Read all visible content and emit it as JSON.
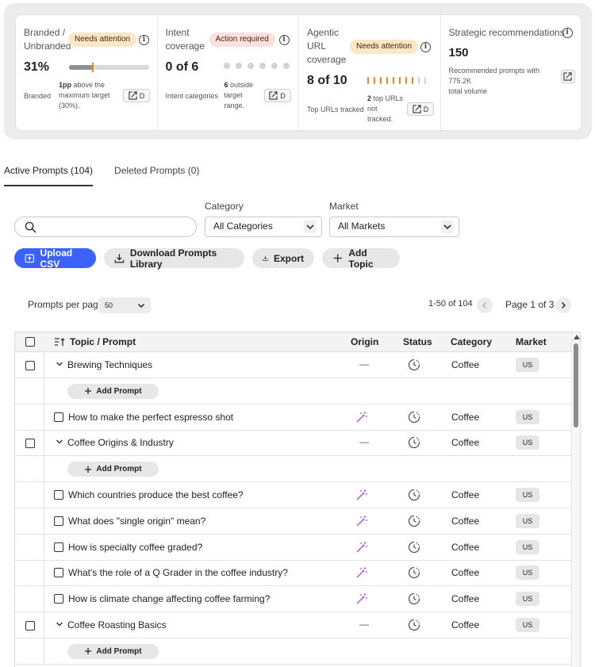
{
  "metrics": {
    "branded": {
      "title_line1": "Branded /",
      "title_line2": "Unbranded",
      "status": "Needs attention",
      "value": "31%",
      "label": "Branded",
      "note_bold": "1pp",
      "note_line1": " above the",
      "note_line2": "maximum target",
      "note_line3": "(30%).",
      "button_label": "D",
      "branded_share": 0.31,
      "max_target": 0.3
    },
    "intent": {
      "title_line1": "Intent",
      "title_line2": "coverage",
      "status": "Action required",
      "value": "0 of 6",
      "label": "Intent categories",
      "note_bold": "6",
      "note_line1": " outside",
      "note_line2": "target",
      "note_line3": "range.",
      "button_label": "D",
      "covered": 0,
      "total": 6
    },
    "agentic": {
      "title_line1": "Agentic",
      "title_line2": "URL",
      "title_line3": "coverage",
      "status": "Needs attention",
      "value": "8 of 10",
      "label": "Top URLs tracked",
      "note_bold": "2",
      "note_line1": " top URLs",
      "note_line2": "not",
      "note_line3": "tracked.",
      "button_label": "D",
      "tracked": 8,
      "total": 10
    },
    "strategic": {
      "title": "Strategic recommendations",
      "value": "150",
      "note_line1": "Recommended prompts with 775.2K",
      "note_line2": "total volume"
    }
  },
  "tabs": [
    {
      "label": "Active Prompts (104)",
      "active": true
    },
    {
      "label": "Deleted Prompts (0)",
      "active": false
    }
  ],
  "filters": {
    "search_placeholder": "",
    "category_label": "Category",
    "category_value": "All Categories",
    "market_label": "Market",
    "market_value": "All Markets"
  },
  "actions": {
    "upload": "Upload CSV",
    "download": "Download Prompts Library",
    "export": "Export",
    "add_topic": "Add Topic"
  },
  "pagination": {
    "per_page_label": "Prompts per page",
    "per_page_value": "50",
    "range": "1-50 of 104",
    "page": "Page 1 of 3"
  },
  "table": {
    "headers": {
      "topic": "Topic / Prompt",
      "origin": "Origin",
      "status": "Status",
      "category": "Category",
      "market": "Market"
    },
    "add_prompt_label": "Add Prompt",
    "dash": "—",
    "rows": [
      {
        "kind": "topic",
        "text": "Brewing Techniques",
        "category": "Coffee",
        "market": "US"
      },
      {
        "kind": "add"
      },
      {
        "kind": "prompt",
        "text": "How to make the perfect espresso shot",
        "category": "Coffee",
        "market": "US"
      },
      {
        "kind": "topic",
        "text": "Coffee Origins & Industry",
        "category": "Coffee",
        "market": "US"
      },
      {
        "kind": "add"
      },
      {
        "kind": "prompt",
        "text": "Which countries produce the best coffee?",
        "category": "Coffee",
        "market": "US"
      },
      {
        "kind": "prompt",
        "text": "What does \"single origin\" mean?",
        "category": "Coffee",
        "market": "US"
      },
      {
        "kind": "prompt",
        "text": "How is specialty coffee graded?",
        "category": "Coffee",
        "market": "US"
      },
      {
        "kind": "prompt",
        "text": "What's the role of a Q Grader in the coffee industry?",
        "category": "Coffee",
        "market": "US"
      },
      {
        "kind": "prompt",
        "text": "How is climate change affecting coffee farming?",
        "category": "Coffee",
        "market": "US"
      },
      {
        "kind": "topic",
        "text": "Coffee Roasting Basics",
        "category": "Coffee",
        "market": "US"
      },
      {
        "kind": "add"
      }
    ]
  },
  "colors": {
    "primary": "#3b63fb",
    "warning": "#e28a14",
    "needs_attention_bg": "#fbe6c6",
    "action_required_bg": "#fde0dc",
    "wand": "#b36ee0"
  }
}
